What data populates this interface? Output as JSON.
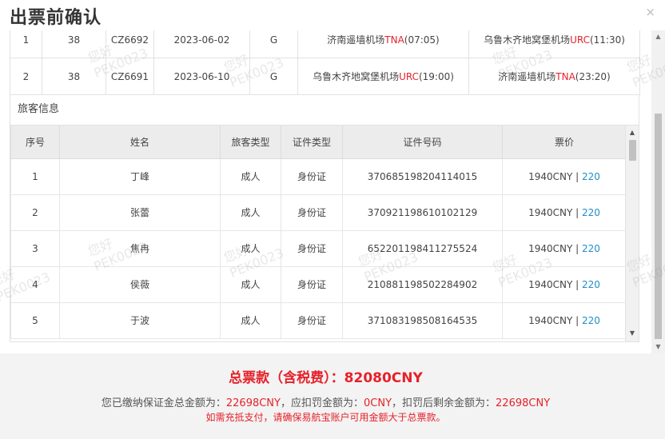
{
  "dialog": {
    "title": "出票前确认",
    "close_symbol": "×"
  },
  "flights": [
    {
      "seq": "1",
      "num": "38",
      "flight_no": "CZ6692",
      "date": "2023-06-02",
      "cabin": "G",
      "dep_name": "济南遥墙机场",
      "dep_code": "TNA",
      "dep_time": "(07:05)",
      "arr_name": "乌鲁木齐地窝堡机场",
      "arr_code": "URC",
      "arr_time": "(11:30)"
    },
    {
      "seq": "2",
      "num": "38",
      "flight_no": "CZ6691",
      "date": "2023-06-10",
      "cabin": "G",
      "dep_name": "乌鲁木齐地窝堡机场",
      "dep_code": "URC",
      "dep_time": "(19:00)",
      "arr_name": "济南遥墙机场",
      "arr_code": "TNA",
      "arr_time": "(23:20)"
    }
  ],
  "passengers_section": {
    "label": "旅客信息"
  },
  "passenger_table": {
    "headers": [
      "序号",
      "姓名",
      "旅客类型",
      "证件类型",
      "证件号码",
      "票价"
    ],
    "rows": [
      {
        "seq": "1",
        "name": "丁峰",
        "type": "成人",
        "id_type": "身份证",
        "id_no": "370685198204114015",
        "fare": "1940CNY",
        "tax": "220"
      },
      {
        "seq": "2",
        "name": "张蕾",
        "type": "成人",
        "id_type": "身份证",
        "id_no": "370921198610102129",
        "fare": "1940CNY",
        "tax": "220"
      },
      {
        "seq": "3",
        "name": "焦冉",
        "type": "成人",
        "id_type": "身份证",
        "id_no": "652201198411275524",
        "fare": "1940CNY",
        "tax": "220"
      },
      {
        "seq": "4",
        "name": "侯薇",
        "type": "成人",
        "id_type": "身份证",
        "id_no": "210881198502284902",
        "fare": "1940CNY",
        "tax": "220"
      },
      {
        "seq": "5",
        "name": "于波",
        "type": "成人",
        "id_type": "身份证",
        "id_no": "371083198508164535",
        "fare": "1940CNY",
        "tax": "220"
      }
    ]
  },
  "watermark": {
    "line1": "您好",
    "line2": "PEK0023"
  },
  "footer": {
    "total_label": "总票款（含税费）：",
    "total_value": "82080CNY",
    "deposit_prefix": "您已缴纳保证金总金额为：",
    "deposit_total": "22698CNY",
    "deposit_mid": "，应扣罚金额为：",
    "penalty": "0CNY",
    "deposit_mid2": "，扣罚后剩余金额为：",
    "remaining": "22698CNY",
    "notice": "如需充抵支付，请确保易航宝账户可用金额大于总票款。"
  },
  "colors": {
    "accent_red": "#e6212a",
    "link_blue": "#1e8ec7",
    "header_gray": "#ececec",
    "footer_bg": "#f3f3f3"
  },
  "icons": {
    "scroll_up": "▲",
    "scroll_down": "▼"
  }
}
